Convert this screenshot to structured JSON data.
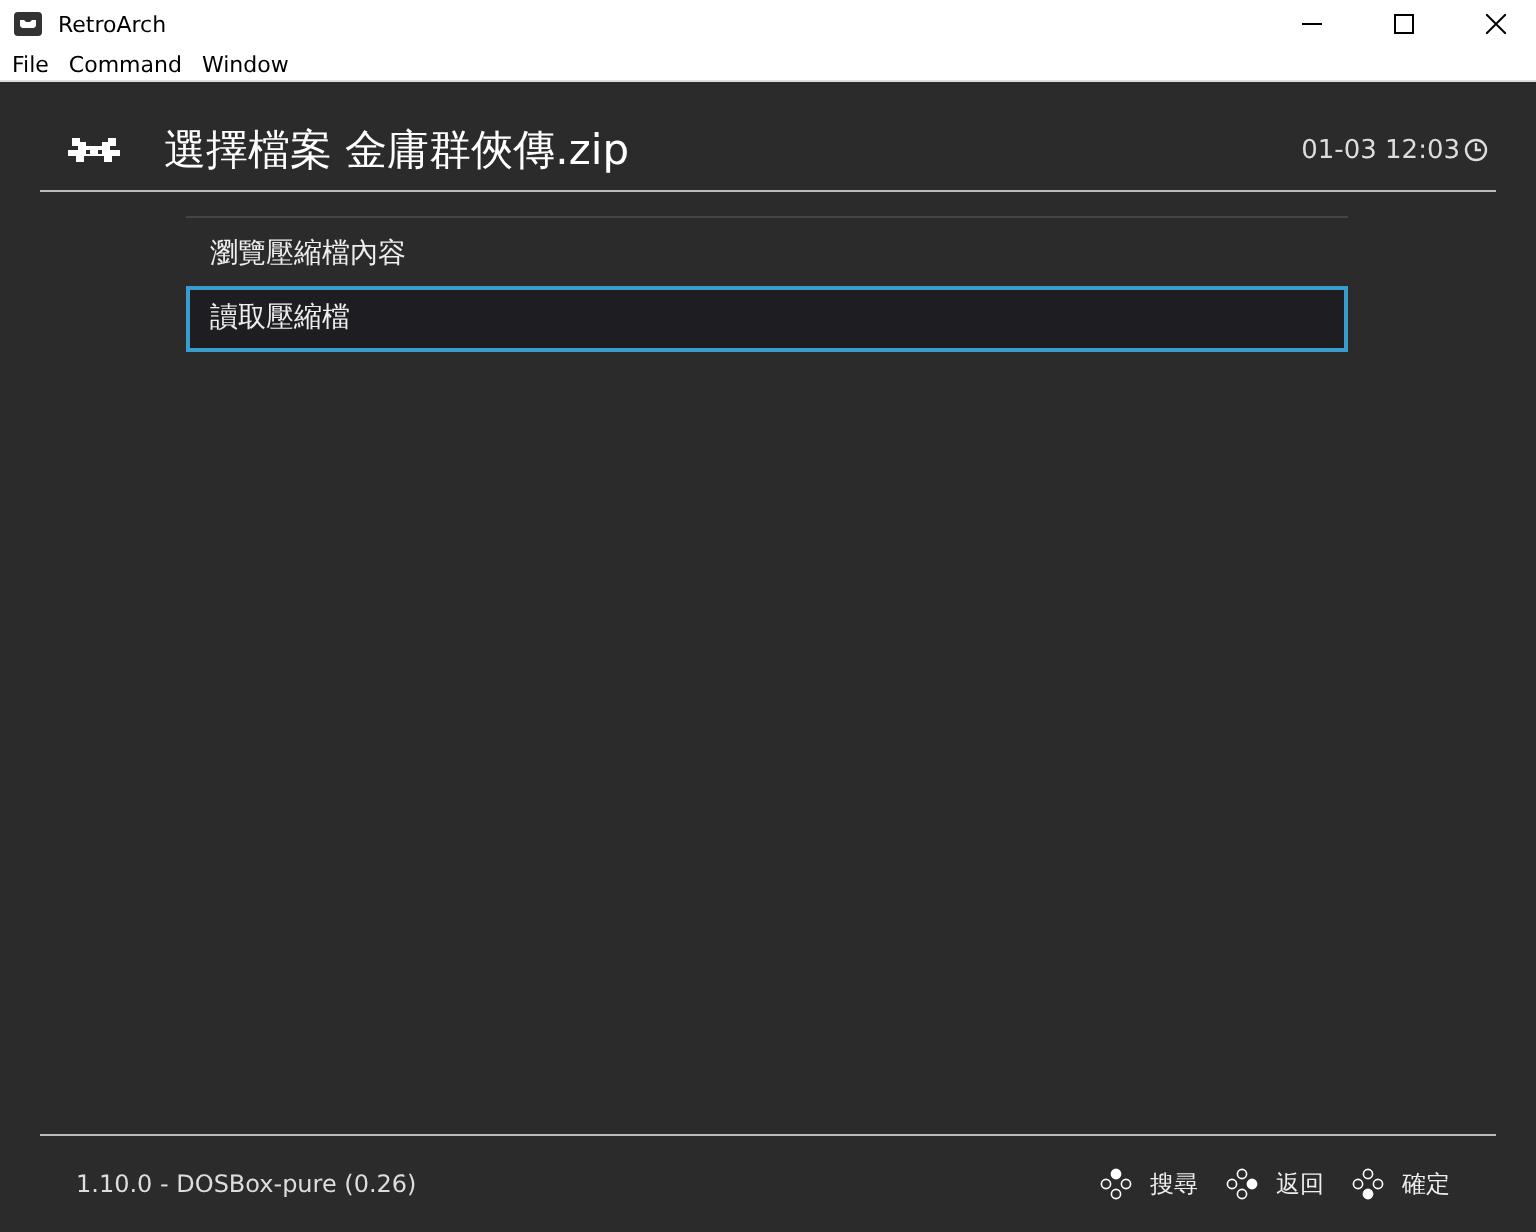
{
  "window": {
    "title": "RetroArch"
  },
  "menu_bar": [
    "File",
    "Command",
    "Window"
  ],
  "header": {
    "title": "選擇檔案 金庸群俠傳.zip",
    "clock": "01-03 12:03"
  },
  "items": [
    {
      "label": "瀏覽壓縮檔內容",
      "selected": false
    },
    {
      "label": "讀取壓縮檔",
      "selected": true
    }
  ],
  "footer": {
    "version": "1.10.0 - DOSBox-pure (0.26)",
    "hints": [
      {
        "kind": "top",
        "label": "搜尋"
      },
      {
        "kind": "right",
        "label": "返回"
      },
      {
        "kind": "bottom",
        "label": "確定"
      }
    ]
  }
}
